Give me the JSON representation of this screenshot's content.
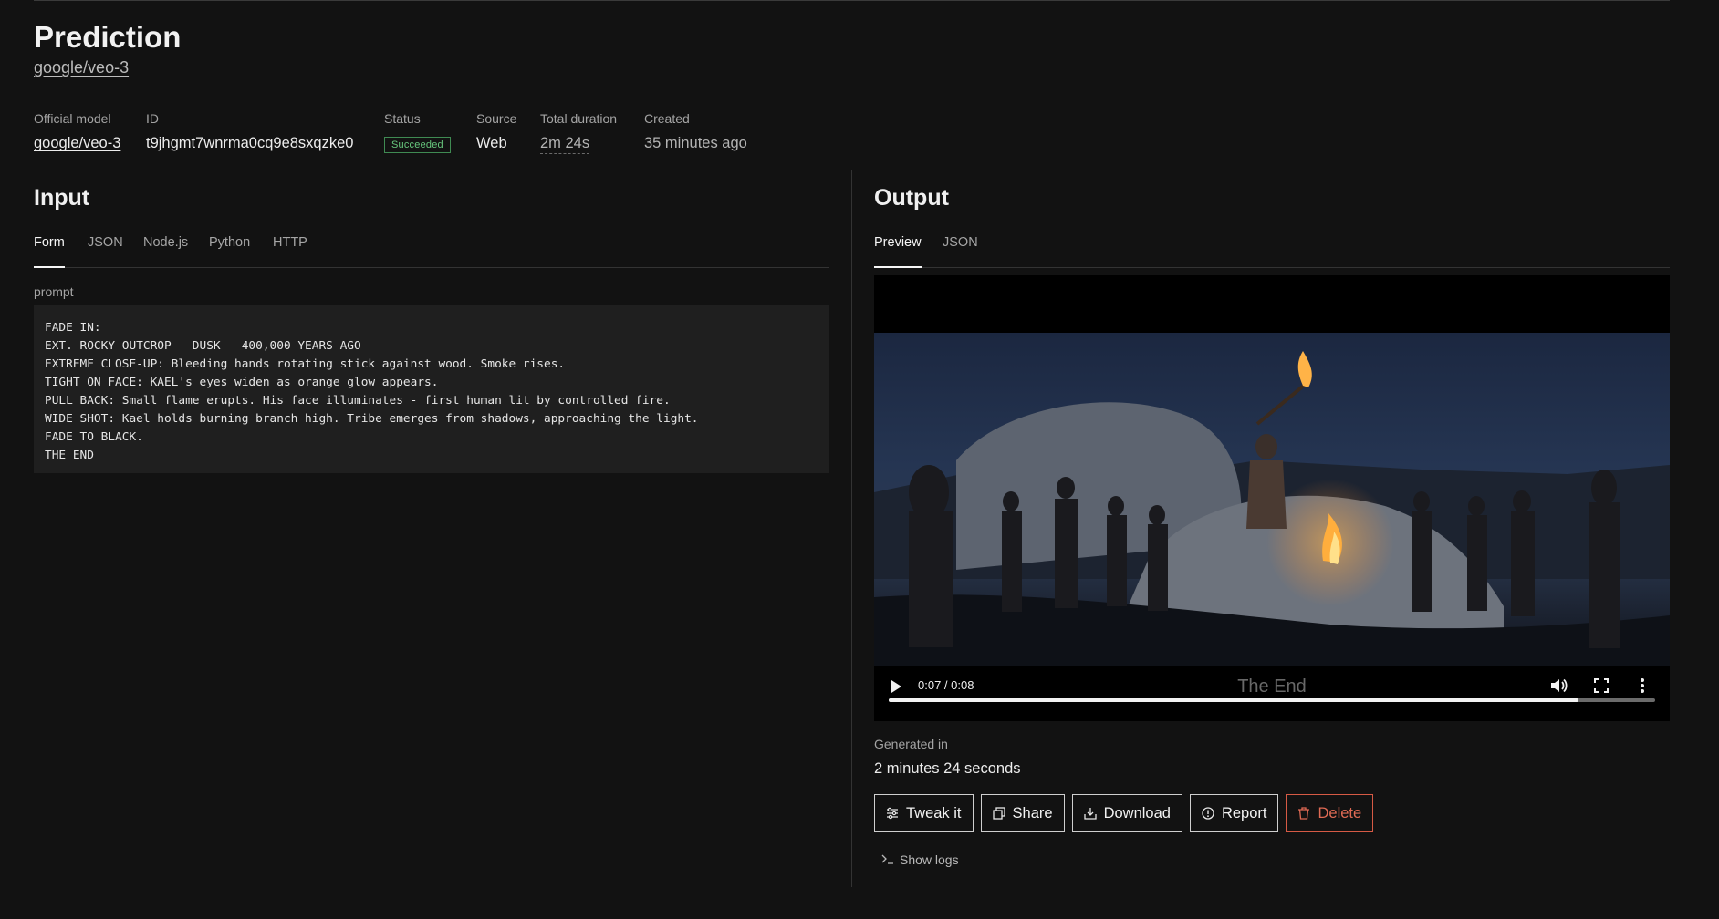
{
  "page": {
    "title": "Prediction",
    "model_link": "google/veo-3"
  },
  "meta": {
    "official_model_label": "Official model",
    "official_model_value": "google/veo-3",
    "id_label": "ID",
    "id_value": "t9jhgmt7wnrma0cq9e8sxqzke0",
    "status_label": "Status",
    "status_value": "Succeeded",
    "source_label": "Source",
    "source_value": "Web",
    "duration_label": "Total duration",
    "duration_value": "2m 24s",
    "created_label": "Created",
    "created_value": "35 minutes ago"
  },
  "input": {
    "title": "Input",
    "tabs": [
      {
        "label": "Form",
        "active": true
      },
      {
        "label": "JSON",
        "active": false
      },
      {
        "label": "Node.js",
        "active": false
      },
      {
        "label": "Python",
        "active": false
      },
      {
        "label": "HTTP",
        "active": false
      }
    ],
    "field_label": "prompt",
    "prompt_lines": [
      "FADE IN:",
      "EXT. ROCKY OUTCROP - DUSK - 400,000 YEARS AGO",
      "EXTREME CLOSE-UP: Bleeding hands rotating stick against wood. Smoke rises.",
      "TIGHT ON FACE: KAEL's eyes widen as orange glow appears.",
      "PULL BACK: Small flame erupts. His face illuminates - first human lit by controlled fire.",
      "WIDE SHOT: Kael holds burning branch high. Tribe emerges from shadows, approaching the light.",
      "FADE TO BLACK.",
      "THE END"
    ]
  },
  "output": {
    "title": "Output",
    "tabs": [
      {
        "label": "Preview",
        "active": true
      },
      {
        "label": "JSON",
        "active": false
      }
    ],
    "video": {
      "time_display": "0:07 / 0:08",
      "caption": "The End",
      "progress_fraction": 0.9
    },
    "generated_label": "Generated in",
    "generated_value": "2 minutes 24 seconds",
    "actions": {
      "tweak": "Tweak it",
      "share": "Share",
      "download": "Download",
      "report": "Report",
      "delete": "Delete"
    },
    "show_logs": "Show logs"
  },
  "icons": {
    "tweak": "sliders-icon",
    "share": "copy-icon",
    "download": "download-icon",
    "report": "alert-circle-icon",
    "delete": "trash-icon",
    "logs": "terminal-icon",
    "play": "play-icon",
    "volume": "volume-icon",
    "fullscreen": "fullscreen-icon",
    "more": "more-vertical-icon"
  },
  "colors": {
    "background": "#121212",
    "success": "#67c77d",
    "danger": "#e06a54"
  }
}
